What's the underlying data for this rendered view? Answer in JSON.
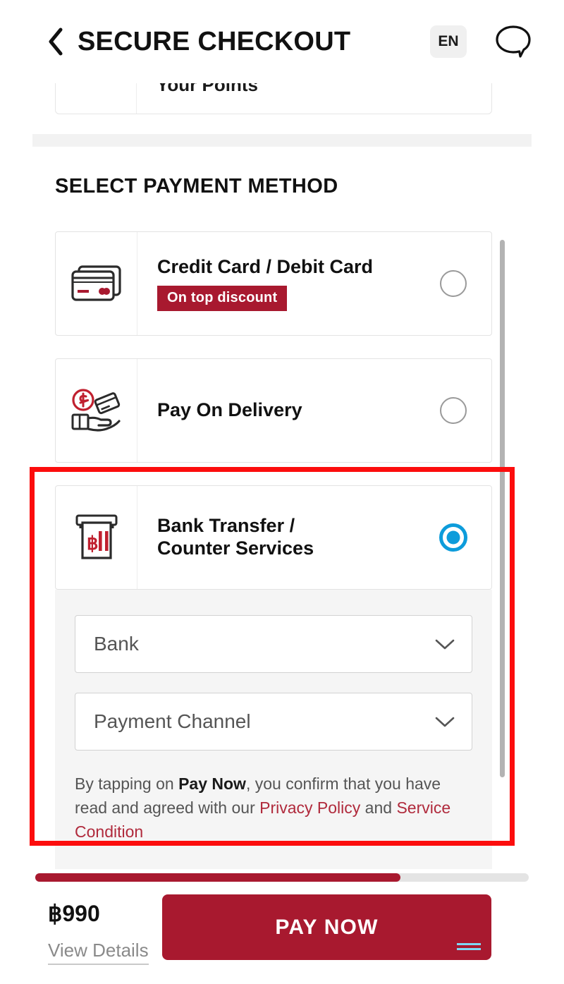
{
  "header": {
    "title": "SECURE CHECKOUT",
    "back_icon": "chevron-left-icon",
    "language": "EN",
    "chat_icon": "chat-bubble-icon"
  },
  "points_card": {
    "label": "Your Points"
  },
  "section": {
    "title": "SELECT PAYMENT METHOD"
  },
  "payment_methods": [
    {
      "id": "credit-card",
      "label": "Credit Card / Debit Card",
      "badge": "On top discount",
      "icon": "credit-card-icon",
      "selected": false
    },
    {
      "id": "pay-on-delivery",
      "label": "Pay On Delivery",
      "badge": "",
      "icon": "hand-cash-icon",
      "selected": false
    },
    {
      "id": "bank-transfer",
      "label_line1": "Bank Transfer /",
      "label_line2": "Counter Services",
      "icon": "atm-deposit-icon",
      "selected": true
    }
  ],
  "bank_panel": {
    "bank_select": "Bank",
    "channel_select": "Payment Channel",
    "chevron_icon": "chevron-down-icon",
    "disclaimer": {
      "part1": "By tapping on ",
      "bold": "Pay Now",
      "part2": ", you confirm that you have read and agreed with our ",
      "link1": "Privacy Policy",
      "part3": " and ",
      "link2": "Service Condition"
    }
  },
  "bottom_bar": {
    "price": "฿990",
    "view_details": "View Details",
    "pay_now": "PAY NOW",
    "progress_percent": 74
  },
  "colors": {
    "brand_red": "#a8192f",
    "link_red": "#b02a3c",
    "selected_blue": "#0d9cdb",
    "annotation_red": "#fc0d0d",
    "panel_gray": "#f5f5f5"
  }
}
